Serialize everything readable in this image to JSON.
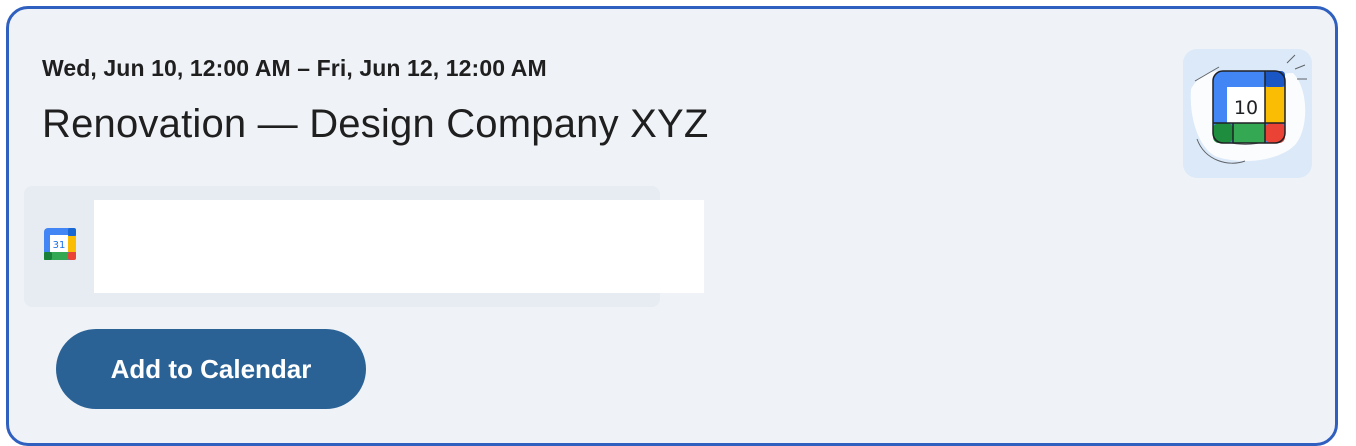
{
  "event": {
    "date_range": "Wed, Jun 10, 12:00 AM – Fri, Jun 12, 12:00 AM",
    "title": "Renovation — Design Company XYZ"
  },
  "thumbnail": {
    "icon": "google-calendar-illustration",
    "day_number": "10"
  },
  "calendar_row": {
    "icon": "google-calendar-icon",
    "icon_day": "31"
  },
  "actions": {
    "add_label": "Add to Calendar"
  },
  "colors": {
    "border": "#2f5fbf",
    "card_background": "#eff3f8",
    "button": "#2b6296",
    "google_blue": "#4285f4",
    "google_red": "#ea4335",
    "google_yellow": "#fbbc04",
    "google_green": "#34a853"
  }
}
